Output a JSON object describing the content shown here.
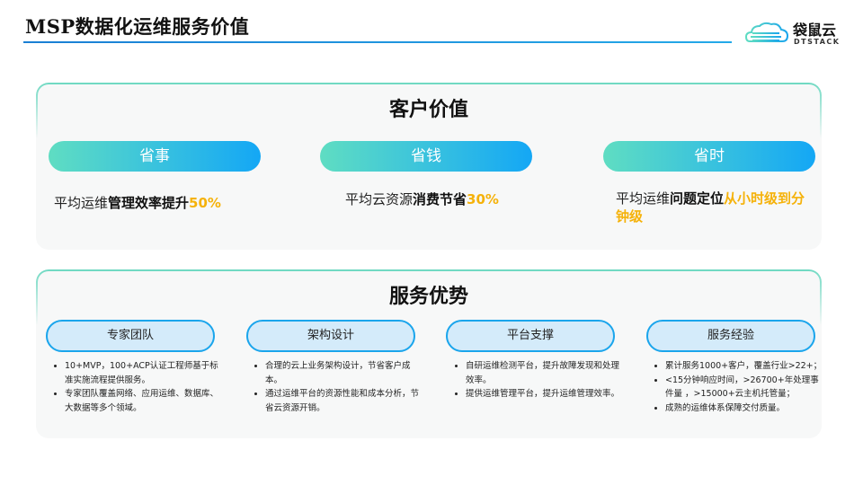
{
  "header": {
    "title": "MSP数据化运维服务价值",
    "logo_cn": "袋鼠云",
    "logo_en": "DTSTACK"
  },
  "customer_value": {
    "title": "客户价值",
    "items": [
      {
        "label": "省事",
        "text_prefix": "平均运维",
        "text_bold": "管理效率提升",
        "text_highlight": "50%"
      },
      {
        "label": "省钱",
        "text_prefix": "平均云资源",
        "text_bold": "消费节省",
        "text_highlight": "30%"
      },
      {
        "label": "省时",
        "text_prefix": "平均运维",
        "text_bold": "问题定位",
        "text_highlight": "从小时级到分钟级"
      }
    ]
  },
  "service_advantages": {
    "title": "服务优势",
    "items": [
      {
        "label": "专家团队",
        "bullets": [
          "10+MVP，100+ACP认证工程师基于标准实施流程提供服务。",
          "专家团队覆盖网络、应用运维、数据库、大数据等多个领域。"
        ]
      },
      {
        "label": "架构设计",
        "bullets": [
          "合理的云上业务架构设计，节省客户成本。",
          "通过运维平台的资源性能和成本分析，节省云资源开销。"
        ]
      },
      {
        "label": "平台支撑",
        "bullets": [
          "自研运维检测平台，提升故障发现和处理效率。",
          "提供运维管理平台，提升运维管理效率。"
        ]
      },
      {
        "label": "服务经验",
        "bullets": [
          "累计服务1000+客户，覆盖行业>22+；",
          "<15分钟响应时间，>26700+年处理事件量 ，>15000+云主机托管量；",
          "成熟的运维体系保障交付质量。"
        ]
      }
    ]
  },
  "colors": {
    "accent_gold": "#f5b20a",
    "pill_start": "#5fddc2",
    "pill_end": "#14a7f5",
    "advantage_border": "#1aa5ec"
  }
}
